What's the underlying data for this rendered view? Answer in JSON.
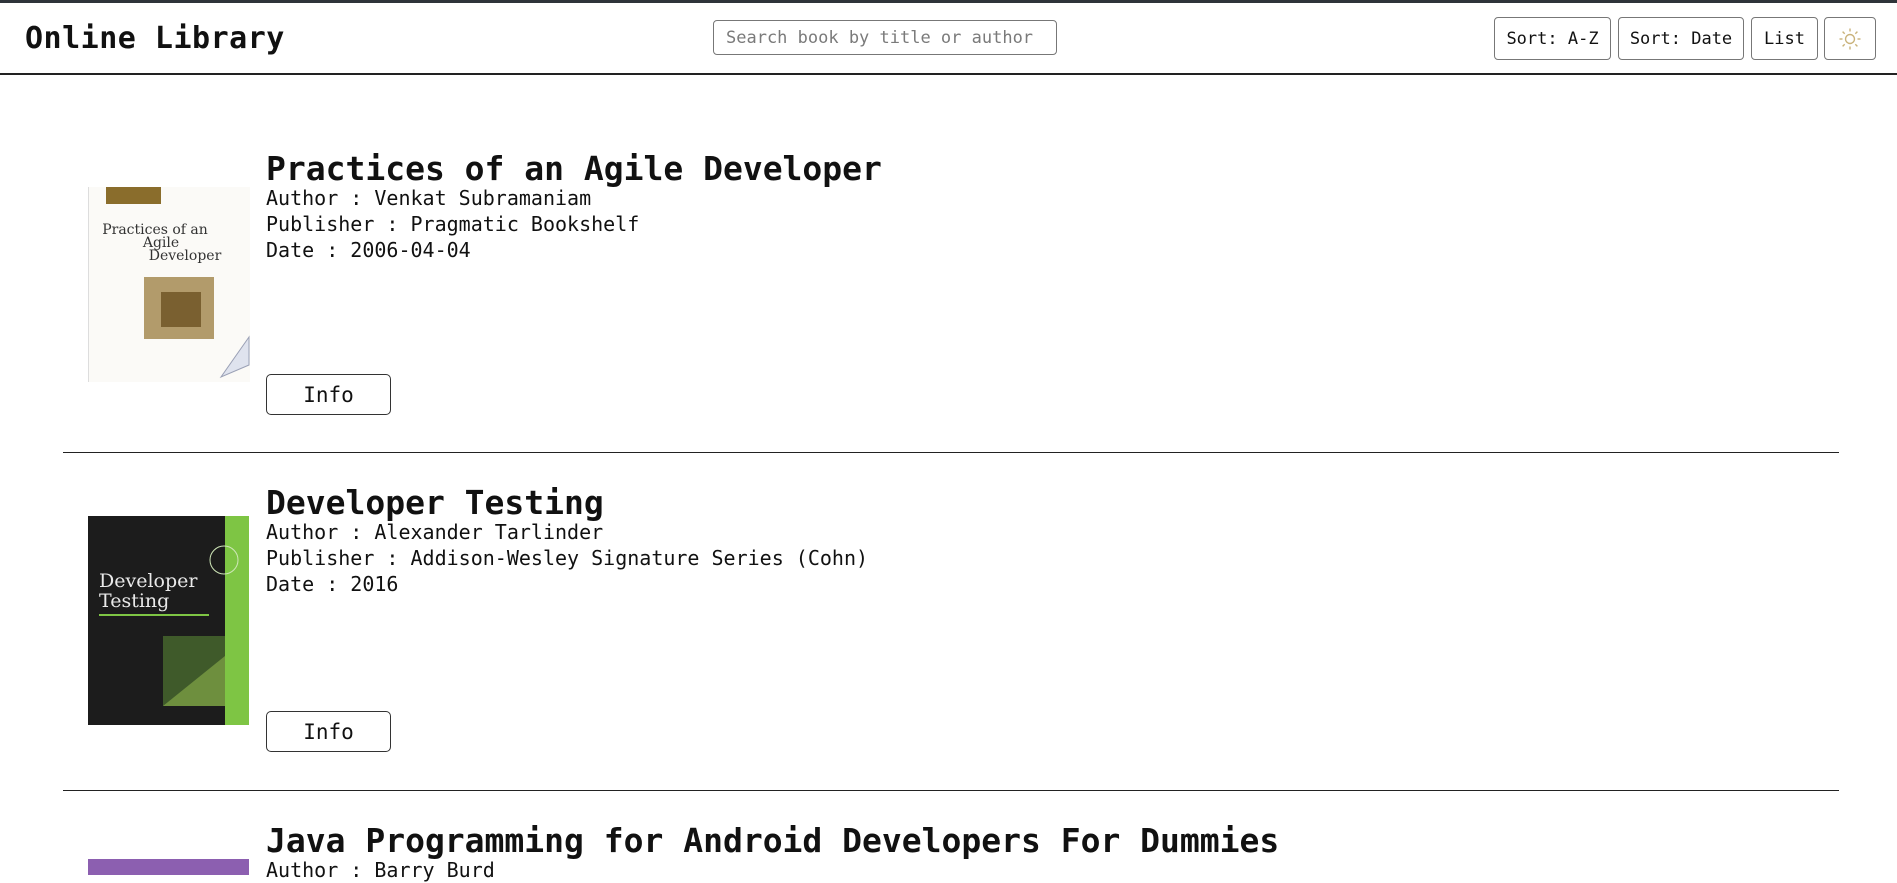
{
  "app": {
    "title": "Online Library"
  },
  "search": {
    "placeholder": "Search book by title or author"
  },
  "toolbar": {
    "sort_az_label": "Sort: A-Z",
    "sort_date_label": "Sort: Date",
    "view_label": "List",
    "theme_icon": "sun-icon"
  },
  "books": [
    {
      "title": "Practices of an Agile Developer",
      "author": "Author : Venkat Subramaniam",
      "publisher": "Publisher : Pragmatic Bookshelf",
      "date": "Date : 2006-04-04",
      "info_label": "Info",
      "cover_text": [
        "Practices of an",
        "Agile",
        "Developer"
      ]
    },
    {
      "title": "Developer Testing",
      "author": "Author : Alexander Tarlinder",
      "publisher": "Publisher : Addison-Wesley Signature Series (Cohn)",
      "date": "Date : 2016",
      "info_label": "Info",
      "cover_text": [
        "Developer",
        "Testing"
      ]
    },
    {
      "title": "Java Programming for Android Developers For Dummies",
      "author": "Author : Barry Burd"
    }
  ],
  "colors": {
    "border": "#222222",
    "text": "#111111",
    "background": "#ffffff"
  }
}
